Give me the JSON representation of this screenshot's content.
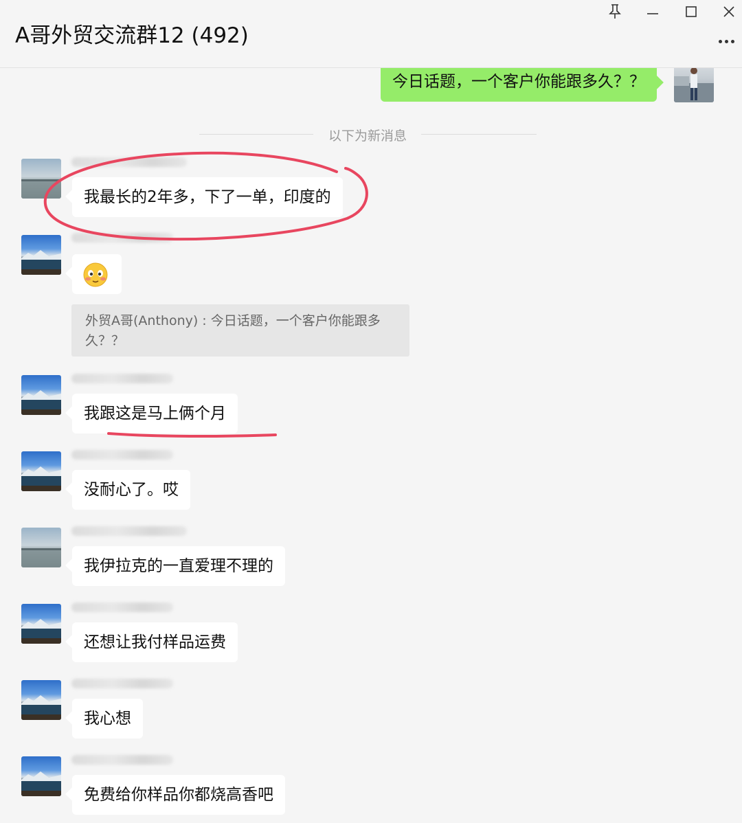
{
  "window": {
    "title": "A哥外贸交流群12 (492)",
    "controls": [
      "pin-icon",
      "minimize-icon",
      "maximize-icon",
      "close-icon"
    ],
    "more_icon": "more-icon"
  },
  "chat": {
    "own_message": "今日话题，一个客户你能跟多久？？",
    "new_messages_divider": "以下为新消息",
    "messages": [
      {
        "text": "我最长的2年多，下了一单，印度的",
        "avatar": "lake-avatar"
      },
      {
        "text": "",
        "avatar": "mountain-lake-avatar",
        "emoji": "blush-emoji"
      },
      {
        "text": "我跟这是马上俩个月",
        "avatar": "mountain-lake-avatar"
      },
      {
        "text": "没耐心了。哎",
        "avatar": "mountain-lake-avatar"
      },
      {
        "text": "我伊拉克的一直爱理不理的",
        "avatar": "lake-avatar"
      },
      {
        "text": "还想让我付样品运费",
        "avatar": "mountain-lake-avatar"
      },
      {
        "text": "我心想",
        "avatar": "mountain-lake-avatar"
      },
      {
        "text": "免费给你样品你都烧高香吧",
        "avatar": "mountain-lake-avatar"
      }
    ],
    "quote": {
      "author": "外贸A哥(Anthony)",
      "separator": " : ",
      "text": "今日话题，一个客户你能跟多久？？"
    }
  },
  "colors": {
    "background": "#f5f5f5",
    "own_bubble": "#95ec69",
    "other_bubble": "#ffffff",
    "annotation": "#e8465f"
  }
}
